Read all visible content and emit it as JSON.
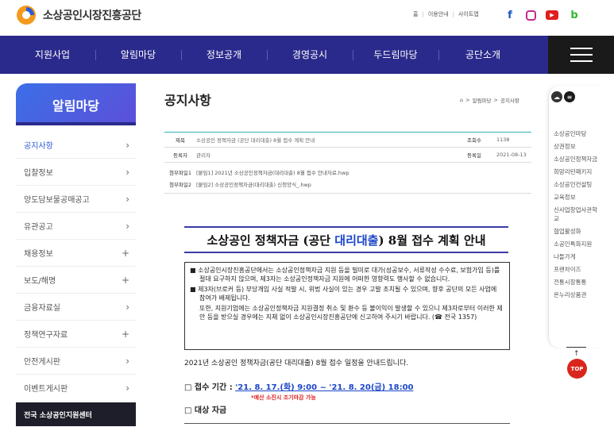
{
  "header": {
    "logo_text": "소상공인시장진흥공단",
    "util_links": [
      "홈",
      "이용안내",
      "사이트맵"
    ],
    "sns": [
      "facebook-icon",
      "instagram-icon",
      "youtube-icon",
      "blog-icon"
    ]
  },
  "gnb": {
    "items": [
      "지원사업",
      "알림마당",
      "정보공개",
      "경영공시",
      "두드림마당",
      "공단소개"
    ]
  },
  "sidebar": {
    "title": "알림마당",
    "items": [
      {
        "label": "공지사항",
        "marker": "›"
      },
      {
        "label": "입찰정보",
        "marker": "›"
      },
      {
        "label": "양도담보물공매공고",
        "marker": "›"
      },
      {
        "label": "유관공고",
        "marker": "›"
      },
      {
        "label": "채용정보",
        "marker": "+"
      },
      {
        "label": "보도/해명",
        "marker": "+"
      },
      {
        "label": "금융자료실",
        "marker": "›"
      },
      {
        "label": "정책연구자료",
        "marker": "+"
      },
      {
        "label": "안전게시판",
        "marker": "›"
      },
      {
        "label": "이벤트게시판",
        "marker": "›"
      }
    ],
    "center_label": "전국 소상공인지원센터"
  },
  "main": {
    "page_title": "공지사항",
    "breadcrumb": [
      "알림마당",
      "공지사항"
    ],
    "post": {
      "title_label": "제목",
      "title": "소상공인 정책자금 (공단 대리대출) 8월 접수 계획 안내",
      "views_label": "조회수",
      "views": "1138",
      "author_label": "등록자",
      "author": "관리자",
      "date_label": "등록일",
      "date": "2021-08-13",
      "attachments": [
        {
          "label": "첨부파일1",
          "name": "[붙임1] 2021년 소상공인정책자금(대리대출) 8월 접수 안내자료.hwp"
        },
        {
          "label": "첨부파일2",
          "name": "[붙임2] 소상공인정책자금(대리대출) 신청양식_.hwp"
        }
      ]
    },
    "notice": {
      "title_a": "소상공인 정책자금 (공단 ",
      "title_hl": "대리대출",
      "title_b": ") 8월 접수 계획 안내",
      "box": [
        "■ 소상공인시장진흥공단에서는 소상공인정책자금 지원 등을 빌미로 대가(성공보수, 서류작성 수수료, 보험가입 등)를 절대 요구하지 않으며, 제3자는 소상공인정책자금 지원에 어떠한 영향력도 행사할 수 없습니다.",
        "■ 제3자(브로커 등) 부당개입 사실 적발 시, 위법 사실이 있는 경우 고발 조치될 수 있으며, 향후 공단의 모든 사업에 참여가 배제됩니다.",
        "또한, 지원기업에는 소상공인정책자금 지원결정 취소 및 환수 등 불이익이 발생할 수 있으니 제3자로부터 이러한 제안 등을 받으실 경우에는 지체 없이 소상공인시장진흥공단에 신고하여 주시기 바랍니다. (☎ 전국 1357)"
      ],
      "intro": "2021년 소상공인 정책자금(공단 대리대출) 8월 접수 일정을 안내드립니다.",
      "period_label": "□ 접수 기간 : ",
      "period_date": "'21. 8. 17.(화) 9:00 ~ '21. 8. 20(금) 18:00",
      "period_note": "*예산 소진시 조기마감 가능",
      "target_label": "□ 대상 자금"
    }
  },
  "quick": {
    "items": [
      "소상공인마당",
      "상권정보",
      "소상공인정책자금",
      "희망리턴패키지",
      "소상공인컨설팅",
      "교육정보",
      "신사업창업사관학교",
      "협업활성화",
      "소공인특화지원",
      "나들가게",
      "프랜차이즈",
      "전통시장통통",
      "온누리상품권"
    ],
    "top_label": "TOP"
  },
  "colors": {
    "nav_bg": "#2a2a8c",
    "accent": "#2a5bd7",
    "highlight": "#1a45c9",
    "warning": "#e02020"
  }
}
